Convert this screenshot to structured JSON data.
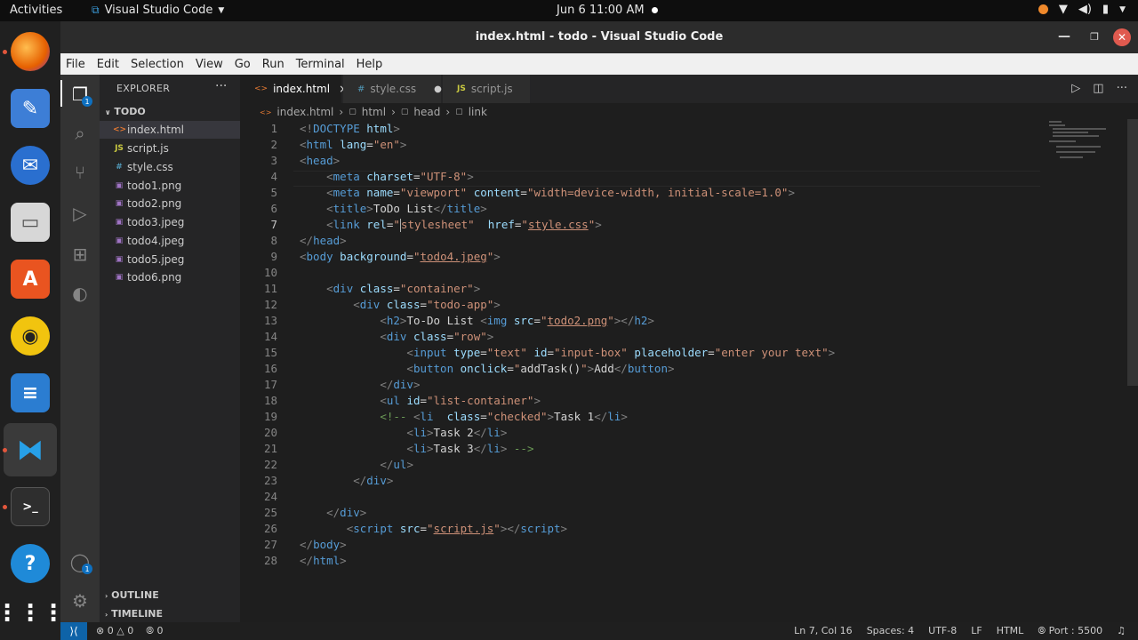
{
  "topbar": {
    "activities": "Activities",
    "app": "Visual Studio Code",
    "clock": "Jun 6  11:00 AM"
  },
  "window": {
    "title": "index.html - todo - Visual Studio Code"
  },
  "menu": [
    "File",
    "Edit",
    "Selection",
    "View",
    "Go",
    "Run",
    "Terminal",
    "Help"
  ],
  "sidebar": {
    "title": "EXPLORER",
    "more": "···",
    "folder": "TODO",
    "files": [
      {
        "name": "index.html",
        "icon": "<>"
      },
      {
        "name": "script.js",
        "icon": "JS"
      },
      {
        "name": "style.css",
        "icon": "#"
      },
      {
        "name": "todo1.png",
        "icon": "▣"
      },
      {
        "name": "todo2.png",
        "icon": "▣"
      },
      {
        "name": "todo3.jpeg",
        "icon": "▣"
      },
      {
        "name": "todo4.jpeg",
        "icon": "▣"
      },
      {
        "name": "todo5.jpeg",
        "icon": "▣"
      },
      {
        "name": "todo6.png",
        "icon": "▣"
      }
    ],
    "outline": "OUTLINE",
    "timeline": "TIMELINE"
  },
  "tabs": [
    {
      "label": "index.html",
      "icon": "<>",
      "state": "×"
    },
    {
      "label": "style.css",
      "icon": "#",
      "state": "●"
    },
    {
      "label": "script.js",
      "icon": "JS",
      "state": ""
    }
  ],
  "breadcrumb": [
    "index.html",
    "html",
    "head",
    "link"
  ],
  "code": {
    "line_numbers": [
      "1",
      "2",
      "3",
      "4",
      "5",
      "6",
      "7",
      "8",
      "9",
      "10",
      "11",
      "12",
      "13",
      "14",
      "15",
      "16",
      "17",
      "18",
      "19",
      "20",
      "21",
      "22",
      "23",
      "24",
      "25",
      "26",
      "27",
      "28"
    ]
  },
  "status": {
    "errors": "0",
    "warnings": "0",
    "ports": "0",
    "position": "Ln 7, Col 16",
    "spaces": "Spaces: 4",
    "encoding": "UTF-8",
    "eol": "LF",
    "language": "HTML",
    "port": "Port : 5500"
  },
  "colors": {
    "accent": "#0e63a8",
    "editor_bg": "#1e1e1e",
    "sidebar_bg": "#252526",
    "tag": "#569cd6",
    "attr": "#9cdcfe",
    "string": "#ce9178",
    "comment": "#6a9955"
  }
}
